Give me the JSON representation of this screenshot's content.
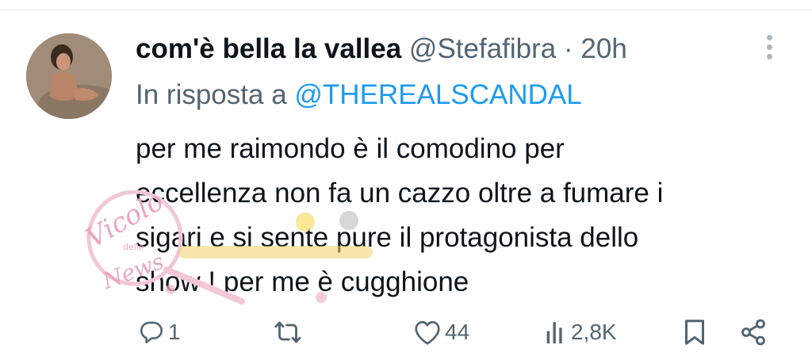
{
  "tweet": {
    "author": {
      "display_name": "com'è bella la vallea",
      "handle": "@Stefafibra",
      "separator": "·",
      "time": "20h"
    },
    "reply_prefix": "In risposta a",
    "reply_handle": "@THEREALSCANDAL",
    "text_lines": [
      "per me raimondo è il comodino per",
      "eccellenza non fa un cazzo oltre a fumare i",
      "sigari e si sente pure il protagonista dello",
      "show ! per me è cugghione"
    ]
  },
  "actions": {
    "replies": "1",
    "retweets": "",
    "likes": "44",
    "views": "2,8K"
  },
  "icons": [
    "more-options-icon",
    "reply-icon",
    "retweet-icon",
    "like-icon",
    "views-icon",
    "bookmark-icon",
    "share-icon"
  ],
  "watermark": {
    "line1": "Vicolo",
    "line2": "delle",
    "line3": "News"
  },
  "colors": {
    "text": "#0f1419",
    "secondary": "#536471",
    "link": "#1d9bf0",
    "watermark": "#e9a5bf"
  }
}
